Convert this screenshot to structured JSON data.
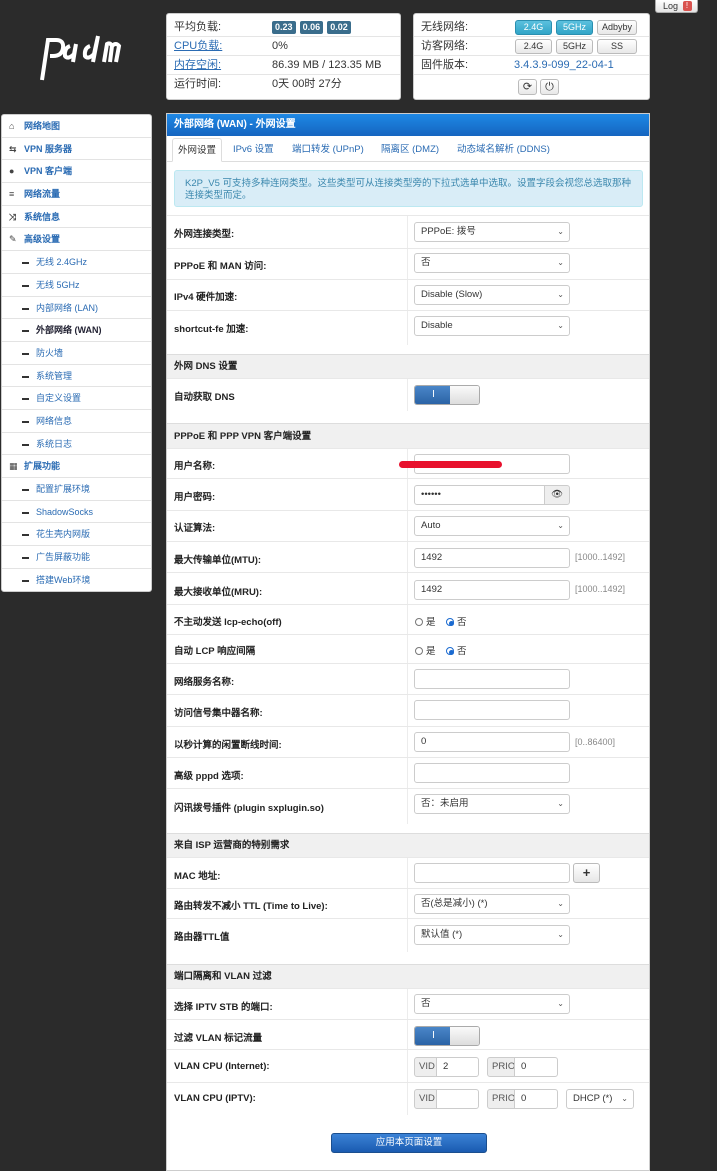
{
  "log": {
    "label": "Log",
    "warn": "!"
  },
  "status": {
    "load_label": "平均负载:",
    "load_values": [
      "0.23",
      "0.06",
      "0.02"
    ],
    "cpu_label": "CPU负载:",
    "cpu_value": "0%",
    "mem_label": "内存空闲:",
    "mem_value": "86.39 MB / 123.35 MB",
    "uptime_label": "运行时间:",
    "uptime_value": "0天 00时 27分"
  },
  "wireless": {
    "wifi_label": "无线网络:",
    "wifi_buttons": [
      "2.4G",
      "5GHz",
      "Adbyby"
    ],
    "guest_label": "访客网络:",
    "guest_buttons": [
      "2.4G",
      "5GHz",
      "SS"
    ],
    "firmware_label": "固件版本:",
    "firmware_value": "3.4.3.9-099_22-04-1"
  },
  "sidebar": {
    "items": [
      {
        "label": "网络地图",
        "icon": "home-icon",
        "glyph": "⌂"
      },
      {
        "label": "VPN 服务器",
        "icon": "exchange-icon",
        "glyph": "⇆"
      },
      {
        "label": "VPN 客户端",
        "icon": "globe-icon",
        "glyph": "●"
      },
      {
        "label": "网络流量",
        "icon": "list-icon",
        "glyph": "≡"
      },
      {
        "label": "系统信息",
        "icon": "random-icon",
        "glyph": "⤨"
      },
      {
        "label": "高级设置",
        "icon": "wrench-icon",
        "glyph": "✎"
      }
    ],
    "advanced": [
      "无线 2.4GHz",
      "无线 5GHz",
      "内部网络 (LAN)",
      "外部网络 (WAN)",
      "防火墙",
      "系统管理",
      "自定义设置",
      "网络信息",
      "系统日志"
    ],
    "ext_label": "扩展功能",
    "ext_glyph": "▦",
    "ext": [
      "配置扩展环境",
      "ShadowSocks",
      "花生壳内网版",
      "广告屏蔽功能",
      "搭建Web环境"
    ]
  },
  "main": {
    "title": "外部网络 (WAN) - 外网设置",
    "tabs": [
      "外网设置",
      "IPv6 设置",
      "端口转发 (UPnP)",
      "隔离区 (DMZ)",
      "动态域名解析 (DDNS)"
    ],
    "alert": "K2P_V5 可支持多种连网类型。这些类型可从连接类型旁的下拉式选单中选取。设置字段会视您总选取那种连接类型而定。",
    "conn_type_label": "外网连接类型:",
    "conn_type_value": "PPPoE: 拨号",
    "man_label": "PPPoE 和 MAN 访问:",
    "man_value": "否",
    "ipv4_label": "IPv4 硬件加速:",
    "ipv4_value": "Disable (Slow)",
    "sfe_label": "shortcut-fe 加速:",
    "sfe_value": "Disable",
    "dns_section": "外网 DNS 设置",
    "dns_auto_label": "自动获取 DNS",
    "toggle_on": "I",
    "ppp_section": "PPPoE 和 PPP VPN 客户端设置",
    "user_label": "用户名称:",
    "pass_label": "用户密码:",
    "pass_value": "••••••",
    "auth_label": "认证算法:",
    "auth_value": "Auto",
    "mtu_label": "最大传输单位(MTU):",
    "mtu_value": "1492",
    "mtu_hint": "[1000..1492]",
    "mru_label": "最大接收单位(MRU):",
    "mru_value": "1492",
    "mru_hint": "[1000..1492]",
    "lcp_echo_label": "不主动发送 lcp-echo(off)",
    "lcp_int_label": "自动 LCP 响应间隔",
    "yes": "是",
    "no": "否",
    "svc_label": "网络服务名称:",
    "ac_label": "访问信号集中器名称:",
    "idle_label": "以秒计算的闲置断线时间:",
    "idle_value": "0",
    "idle_hint": "[0..86400]",
    "pppd_label": "高级 pppd 选项:",
    "plugin_label": "闪讯拨号插件 (plugin sxplugin.so)",
    "plugin_value": "否：未启用",
    "isp_section": "来自 ISP 运营商的特别需求",
    "mac_label": "MAC 地址:",
    "mac_add": "+",
    "ttl_label": "路由转发不减小 TTL (Time to Live):",
    "ttl_value": "否(总是减小) (*)",
    "rttl_label": "路由器TTL值",
    "rttl_value": "默认值 (*)",
    "vlan_section": "端口隔离和 VLAN 过滤",
    "stb_label": "选择 IPTV STB 的端口:",
    "stb_value": "否",
    "vlanf_label": "过滤 VLAN 标记流量",
    "vcpu_inet_label": "VLAN CPU (Internet):",
    "vcpu_iptv_label": "VLAN CPU (IPTV):",
    "vid": "VID",
    "prio": "PRIO",
    "vid_inet": "2",
    "prio_inet": "0",
    "prio_iptv": "0",
    "dhcp_value": "DHCP (*)",
    "apply": "应用本页面设置"
  },
  "colors": {
    "header": "#1565c0",
    "accent": "#2a6bb3",
    "alert_bg": "#d9edf7"
  }
}
